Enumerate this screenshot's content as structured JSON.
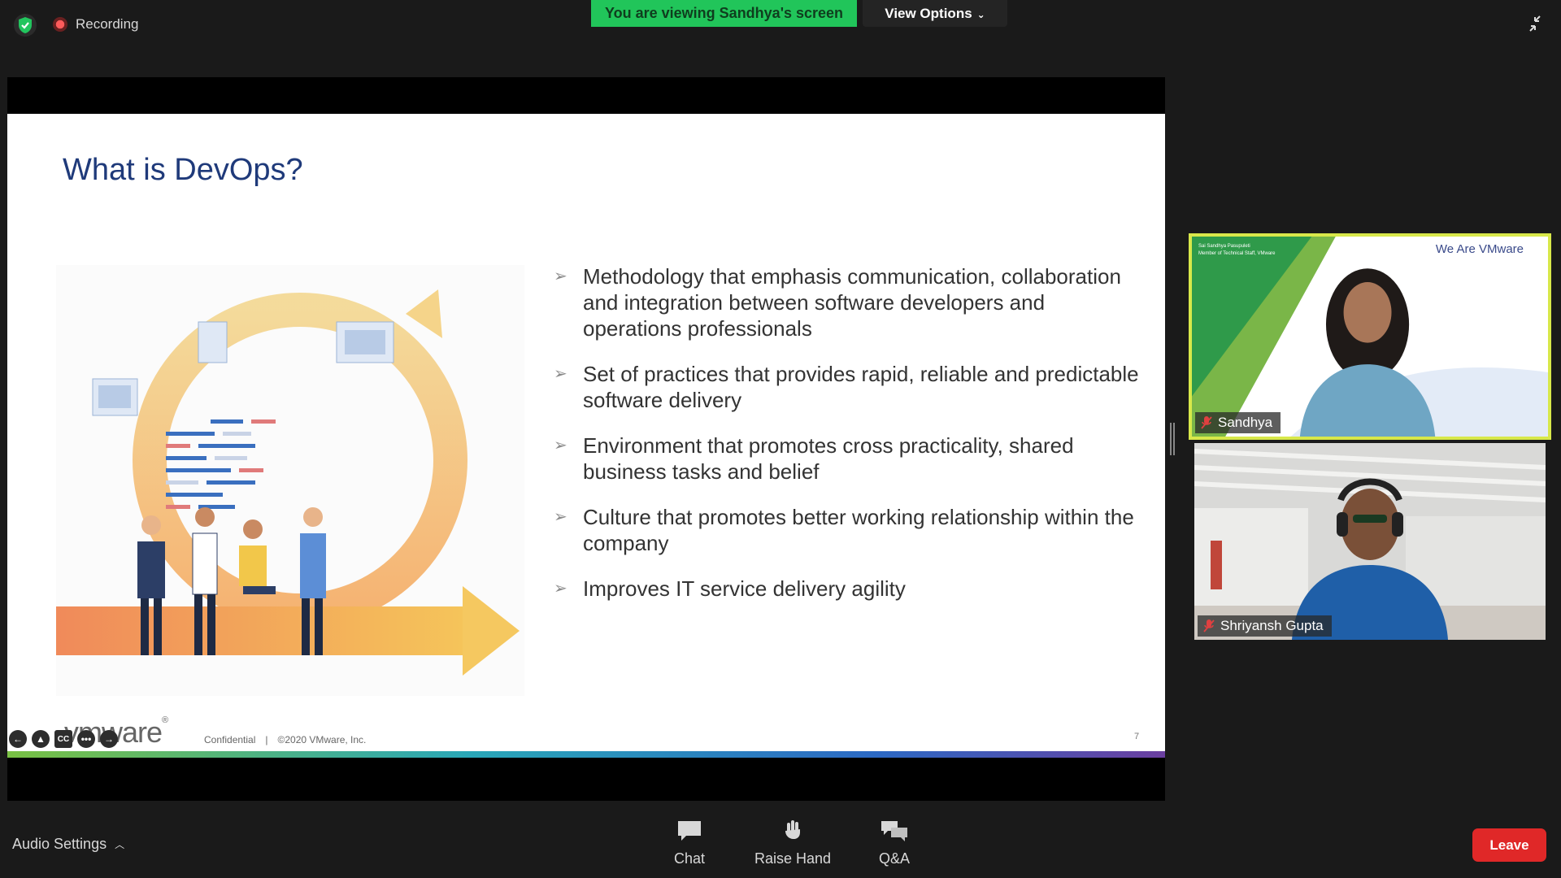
{
  "top_bar": {
    "recording_label": "Recording",
    "viewing_banner": "You are viewing Sandhya's screen",
    "view_options_label": "View Options"
  },
  "slide": {
    "title": "What is DevOps?",
    "bullets": [
      "Methodology that emphasis communication, collaboration and integration between software developers and operations professionals",
      "Set of practices that provides rapid, reliable and predictable software delivery",
      "Environment that promotes cross practicality, shared business tasks and belief",
      "Culture that promotes better working relationship within the company",
      "Improves IT service delivery agility"
    ],
    "logo_text": "vmware",
    "logo_reg": "®",
    "footer_confidential": "Confidential",
    "footer_separator": "|",
    "footer_copyright": "©2020 VMware, Inc.",
    "page_number": "7",
    "controls": [
      "←",
      "▲",
      "CC",
      "•••",
      "→"
    ]
  },
  "participants": [
    {
      "name": "Sandhya",
      "muted": true,
      "overlay_title": "We Are VMware",
      "card_line1": "Sai Sandhya Pasupuleti",
      "card_line2": "Member of Technical Staff, VMware"
    },
    {
      "name": "Shriyansh Gupta",
      "muted": true
    }
  ],
  "bottom_bar": {
    "audio_settings_label": "Audio Settings",
    "chat_label": "Chat",
    "raise_hand_label": "Raise Hand",
    "qa_label": "Q&A",
    "leave_label": "Leave"
  },
  "colors": {
    "viewing_banner": "#21c55a",
    "leave_button": "#e02828",
    "active_speaker_border": "#d8e84a",
    "slide_title": "#1f3a7a"
  }
}
